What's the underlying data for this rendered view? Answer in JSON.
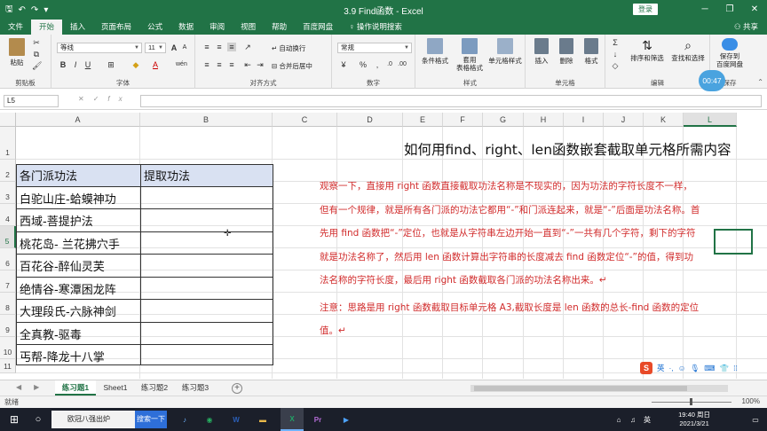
{
  "window": {
    "title": "3.9 Find函数 - Excel",
    "login": "登录",
    "buttons": {
      "min": "─",
      "restore": "❐",
      "close": "✕"
    }
  },
  "tabs": [
    "文件",
    "开始",
    "插入",
    "页面布局",
    "公式",
    "数据",
    "审阅",
    "视图",
    "帮助",
    "百度网盘"
  ],
  "tell_me": "操作说明搜索",
  "share": "共享",
  "ribbon": {
    "clipboard": {
      "label": "剪贴板",
      "paste": "粘贴"
    },
    "font": {
      "label": "字体",
      "name": "等线",
      "size": "11",
      "bold": "B",
      "italic": "I",
      "underline": "U",
      "grow": "A",
      "shrink": "A",
      "wen": "wén"
    },
    "alignment": {
      "label": "对齐方式",
      "wrap": "自动换行",
      "merge": "合并后居中"
    },
    "number": {
      "label": "数字",
      "format": "常规",
      "currency": "¥",
      "percent": "%",
      "comma": ","
    },
    "styles": {
      "label": "样式",
      "conditional": "条件格式",
      "table": "套用\n表格格式",
      "cell": "单元格样式"
    },
    "cells": {
      "label": "单元格",
      "insert": "插入",
      "delete": "删除",
      "format": "格式"
    },
    "editing": {
      "label": "编辑",
      "sort": "排序和筛选",
      "find": "查找和选择"
    },
    "save": {
      "label": "保存到\n百度网盘",
      "group": "保存"
    }
  },
  "timer": "00:47",
  "formula_bar": {
    "name_box": "L5",
    "fx": "fx",
    "value": ""
  },
  "columns": [
    "A",
    "B",
    "C",
    "D",
    "E",
    "F",
    "G",
    "H",
    "I",
    "J",
    "K",
    "L"
  ],
  "rows": [
    "1",
    "2",
    "3",
    "4",
    "5",
    "6",
    "7",
    "8",
    "9",
    "10",
    "11"
  ],
  "selected_cell": "L5",
  "table": {
    "headers": [
      "各门派功法",
      "提取功法"
    ],
    "rows": [
      "白驼山庄-蛤蟆神功",
      "西域-菩提护法",
      "桃花岛- 兰花拂穴手",
      "百花谷-醉仙灵芙",
      "绝情谷-寒潭困龙阵",
      "大理段氏-六脉神剑",
      "全真教-驱毒",
      "丐帮-降龙十八掌"
    ]
  },
  "heading": "如何用find、right、len函数嵌套截取单元格所需内容",
  "notes": {
    "paragraph1": "观察一下，直接用 right 函数直接截取功法名称是不现实的，因为功法的字符长度不一样，但有一个规律，就是所有各门派的功法它都用“-”和门派连起来，就是“-”后面是功法名称。首先用 find 函数把“-”定位，也就是从字符串左边开始一直到“-”一共有几个字符，剩下的字符就是功法名称了，然后用 len 函数计算出字符串的长度减去 find 函数定位“-”的值，得到功法名称的字符长度，最后用 right 函数截取各门派的功法名称出来。↵",
    "paragraph2": "注意：思路是用 right 函数截取目标单元格 A3,截取长度是 len 函数的总长-find 函数的定位值。↵"
  },
  "ime": {
    "logo": "S",
    "lang": "英"
  },
  "sheet_tabs": [
    "练习题1",
    "Sheet1",
    "练习题2",
    "练习题3"
  ],
  "active_sheet": "练习题1",
  "status": {
    "ready": "就绪",
    "zoom": "100%"
  },
  "taskbar": {
    "search_text": "欧冠八强出炉",
    "search_button": "搜索一下",
    "lang": "英",
    "time": "19:40 周日",
    "date": "2021/3/21"
  }
}
